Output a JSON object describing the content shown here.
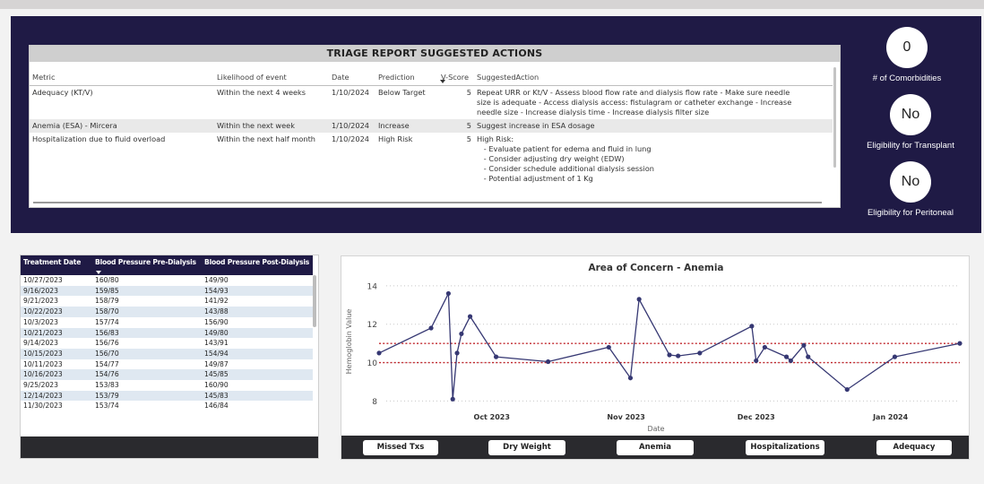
{
  "triage": {
    "title": "TRIAGE REPORT SUGGESTED ACTIONS",
    "columns": [
      "Metric",
      "Likelihood of event",
      "Date",
      "Prediction",
      "V-Score",
      "SuggestedAction"
    ],
    "rows": [
      {
        "metric": "Adequacy (KT/V)",
        "likelihood": "Within the next 4 weeks",
        "date": "1/10/2024",
        "prediction": "Below Target",
        "vscore": "5",
        "action": [
          "Repeat URR or Kt/V - Assess blood flow rate and dialysis flow rate - Make sure needle",
          "size is adequate - Access dialysis access: fistulagram or catheter exchange - Increase",
          "needle size - Increase dialysis time - Increase dialysis filter size"
        ]
      },
      {
        "metric": "Anemia (ESA) - Mircera",
        "likelihood": "Within the next week",
        "date": "1/10/2024",
        "prediction": "Increase",
        "vscore": "5",
        "action": [
          "Suggest increase in ESA dosage"
        ]
      },
      {
        "metric": "Hospitalization due to fluid overload",
        "likelihood": "Within the next half month",
        "date": "1/10/2024",
        "prediction": "High Risk",
        "vscore": "5",
        "action": [
          "High Risk:",
          "   - Evaluate patient for edema and fluid in lung",
          "   - Consider adjusting dry weight (EDW)",
          "   - Consider schedule additional dialysis session",
          "   - Potential adjustment of 1 Kg"
        ]
      }
    ]
  },
  "kpis": [
    {
      "value": "0",
      "label": "# of Comorbidities"
    },
    {
      "value": "No",
      "label": "Eligibility for Transplant"
    },
    {
      "value": "No",
      "label": "Eligibility for Peritoneal"
    }
  ],
  "treatments": {
    "columns": [
      "Treatment Date",
      "Blood Pressure Pre-Dialysis",
      "Blood Pressure Post-Dialysis"
    ],
    "rows": [
      [
        "10/27/2023",
        "160/80",
        "149/90"
      ],
      [
        "9/16/2023",
        "159/85",
        "154/93"
      ],
      [
        "9/21/2023",
        "158/79",
        "141/92"
      ],
      [
        "10/22/2023",
        "158/70",
        "143/88"
      ],
      [
        "10/3/2023",
        "157/74",
        "156/90"
      ],
      [
        "10/21/2023",
        "156/83",
        "149/80"
      ],
      [
        "9/14/2023",
        "156/76",
        "143/91"
      ],
      [
        "10/15/2023",
        "156/70",
        "154/94"
      ],
      [
        "10/11/2023",
        "154/77",
        "149/87"
      ],
      [
        "10/16/2023",
        "154/76",
        "145/85"
      ],
      [
        "9/25/2023",
        "153/83",
        "160/90"
      ],
      [
        "12/14/2023",
        "153/79",
        "145/83"
      ],
      [
        "11/30/2023",
        "153/74",
        "146/84"
      ]
    ]
  },
  "chart_data": {
    "type": "line",
    "title": "Area of Concern - Anemia",
    "xlabel": "Date",
    "ylabel": "Hemoglobin Value",
    "xlim": [
      "2023-09-05",
      "2024-01-17"
    ],
    "ylim": [
      7.6,
      14.6
    ],
    "yticks": [
      8,
      10,
      12,
      14
    ],
    "xticks": [
      {
        "date": "2023-10-01",
        "label": "Oct 2023"
      },
      {
        "date": "2023-11-01",
        "label": "Nov 2023"
      },
      {
        "date": "2023-12-01",
        "label": "Dec 2023"
      },
      {
        "date": "2024-01-01",
        "label": "Jan 2024"
      }
    ],
    "grid": "horizontal dotted",
    "reference_lines": [
      11,
      10
    ],
    "colors": {
      "line": "#363873",
      "reference": "#c0272d",
      "grid": "#c8c8c8"
    },
    "series": [
      {
        "points": [
          {
            "x": "2023-09-05",
            "y": 10.5
          },
          {
            "x": "2023-09-17",
            "y": 11.8
          },
          {
            "x": "2023-09-21",
            "y": 13.6
          },
          {
            "x": "2023-09-22",
            "y": 8.1
          },
          {
            "x": "2023-09-23",
            "y": 10.5
          },
          {
            "x": "2023-09-24",
            "y": 11.5
          },
          {
            "x": "2023-09-26",
            "y": 12.4
          },
          {
            "x": "2023-10-02",
            "y": 10.3
          },
          {
            "x": "2023-10-14",
            "y": 10.05
          },
          {
            "x": "2023-10-28",
            "y": 10.8
          },
          {
            "x": "2023-11-02",
            "y": 9.2
          },
          {
            "x": "2023-11-04",
            "y": 13.3
          },
          {
            "x": "2023-11-11",
            "y": 10.4
          },
          {
            "x": "2023-11-13",
            "y": 10.35
          },
          {
            "x": "2023-11-18",
            "y": 10.5
          },
          {
            "x": "2023-11-30",
            "y": 11.9
          },
          {
            "x": "2023-12-01",
            "y": 10.1
          },
          {
            "x": "2023-12-03",
            "y": 10.8
          },
          {
            "x": "2023-12-08",
            "y": 10.3
          },
          {
            "x": "2023-12-09",
            "y": 10.1
          },
          {
            "x": "2023-12-12",
            "y": 10.9
          },
          {
            "x": "2023-12-13",
            "y": 10.3
          },
          {
            "x": "2023-12-22",
            "y": 8.6
          },
          {
            "x": "2024-01-02",
            "y": 10.3
          },
          {
            "x": "2024-01-17",
            "y": 11.0
          }
        ]
      }
    ]
  },
  "nav_buttons": [
    "Missed Txs",
    "Dry Weight",
    "Anemia",
    "Hospitalizations",
    "Adequacy"
  ]
}
